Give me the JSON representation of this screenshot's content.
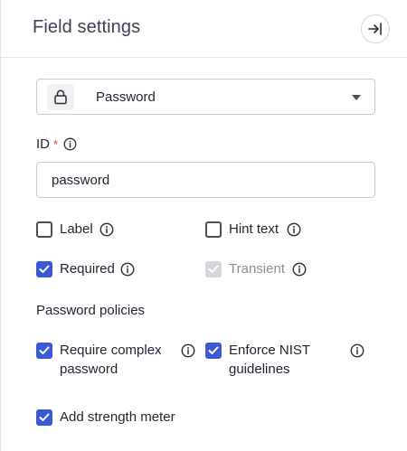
{
  "header": {
    "title": "Field settings",
    "collapse_icon": "collapse-panel-icon"
  },
  "field_type": {
    "icon": "lock-icon",
    "selected": "Password"
  },
  "id_field": {
    "label": "ID",
    "required_marker": "*",
    "value": "password"
  },
  "options": {
    "label": {
      "text": "Label",
      "checked": false
    },
    "hint_text": {
      "text": "Hint text",
      "checked": false
    },
    "required": {
      "text": "Required",
      "checked": true
    },
    "transient": {
      "text": "Transient",
      "checked": true,
      "disabled": true
    }
  },
  "password_policies": {
    "heading": "Password policies",
    "require_complex": {
      "text_line1": "Require complex",
      "text_line2": "password",
      "checked": true
    },
    "enforce_nist": {
      "text_line1": "Enforce NIST",
      "text_line2": "guidelines",
      "checked": true
    },
    "strength_meter": {
      "text": "Add strength meter",
      "checked": true
    }
  },
  "colors": {
    "accent": "#3d5ad6",
    "required": "#d93a3a",
    "border": "#c8cad0"
  }
}
